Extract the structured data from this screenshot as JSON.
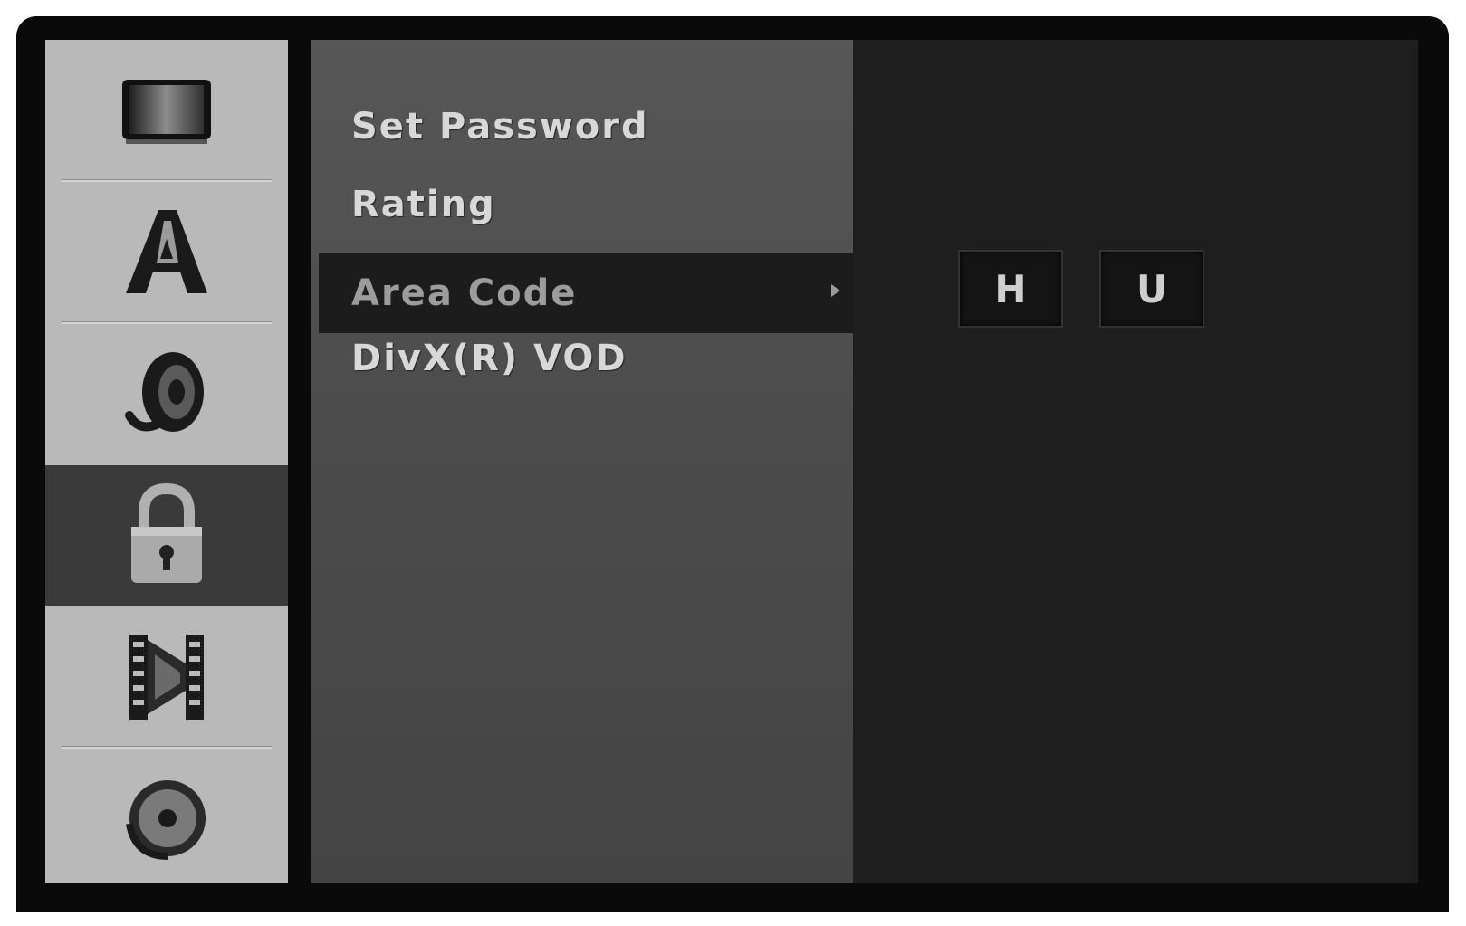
{
  "sidebar": {
    "items": [
      {
        "icon": "display-icon",
        "selected": false
      },
      {
        "icon": "language-icon",
        "selected": false
      },
      {
        "icon": "audio-icon",
        "selected": false
      },
      {
        "icon": "lock-icon",
        "selected": true
      },
      {
        "icon": "recording-icon",
        "selected": false
      },
      {
        "icon": "disc-icon",
        "selected": false
      }
    ]
  },
  "menu": {
    "items": [
      {
        "label": "Set Password"
      },
      {
        "label": "Rating"
      },
      {
        "label": "Area Code",
        "selected": true
      },
      {
        "label": "DivX(R) VOD"
      }
    ]
  },
  "area_code": {
    "chars": [
      "H",
      "U"
    ]
  },
  "colors": {
    "sidebar": "#b9b9b9",
    "sidebar_selected": "#3a3a3a",
    "menu_panel": "#4f4f4f",
    "menu_highlight": "#1c1c1c",
    "value_panel": "#1e1e1e"
  }
}
